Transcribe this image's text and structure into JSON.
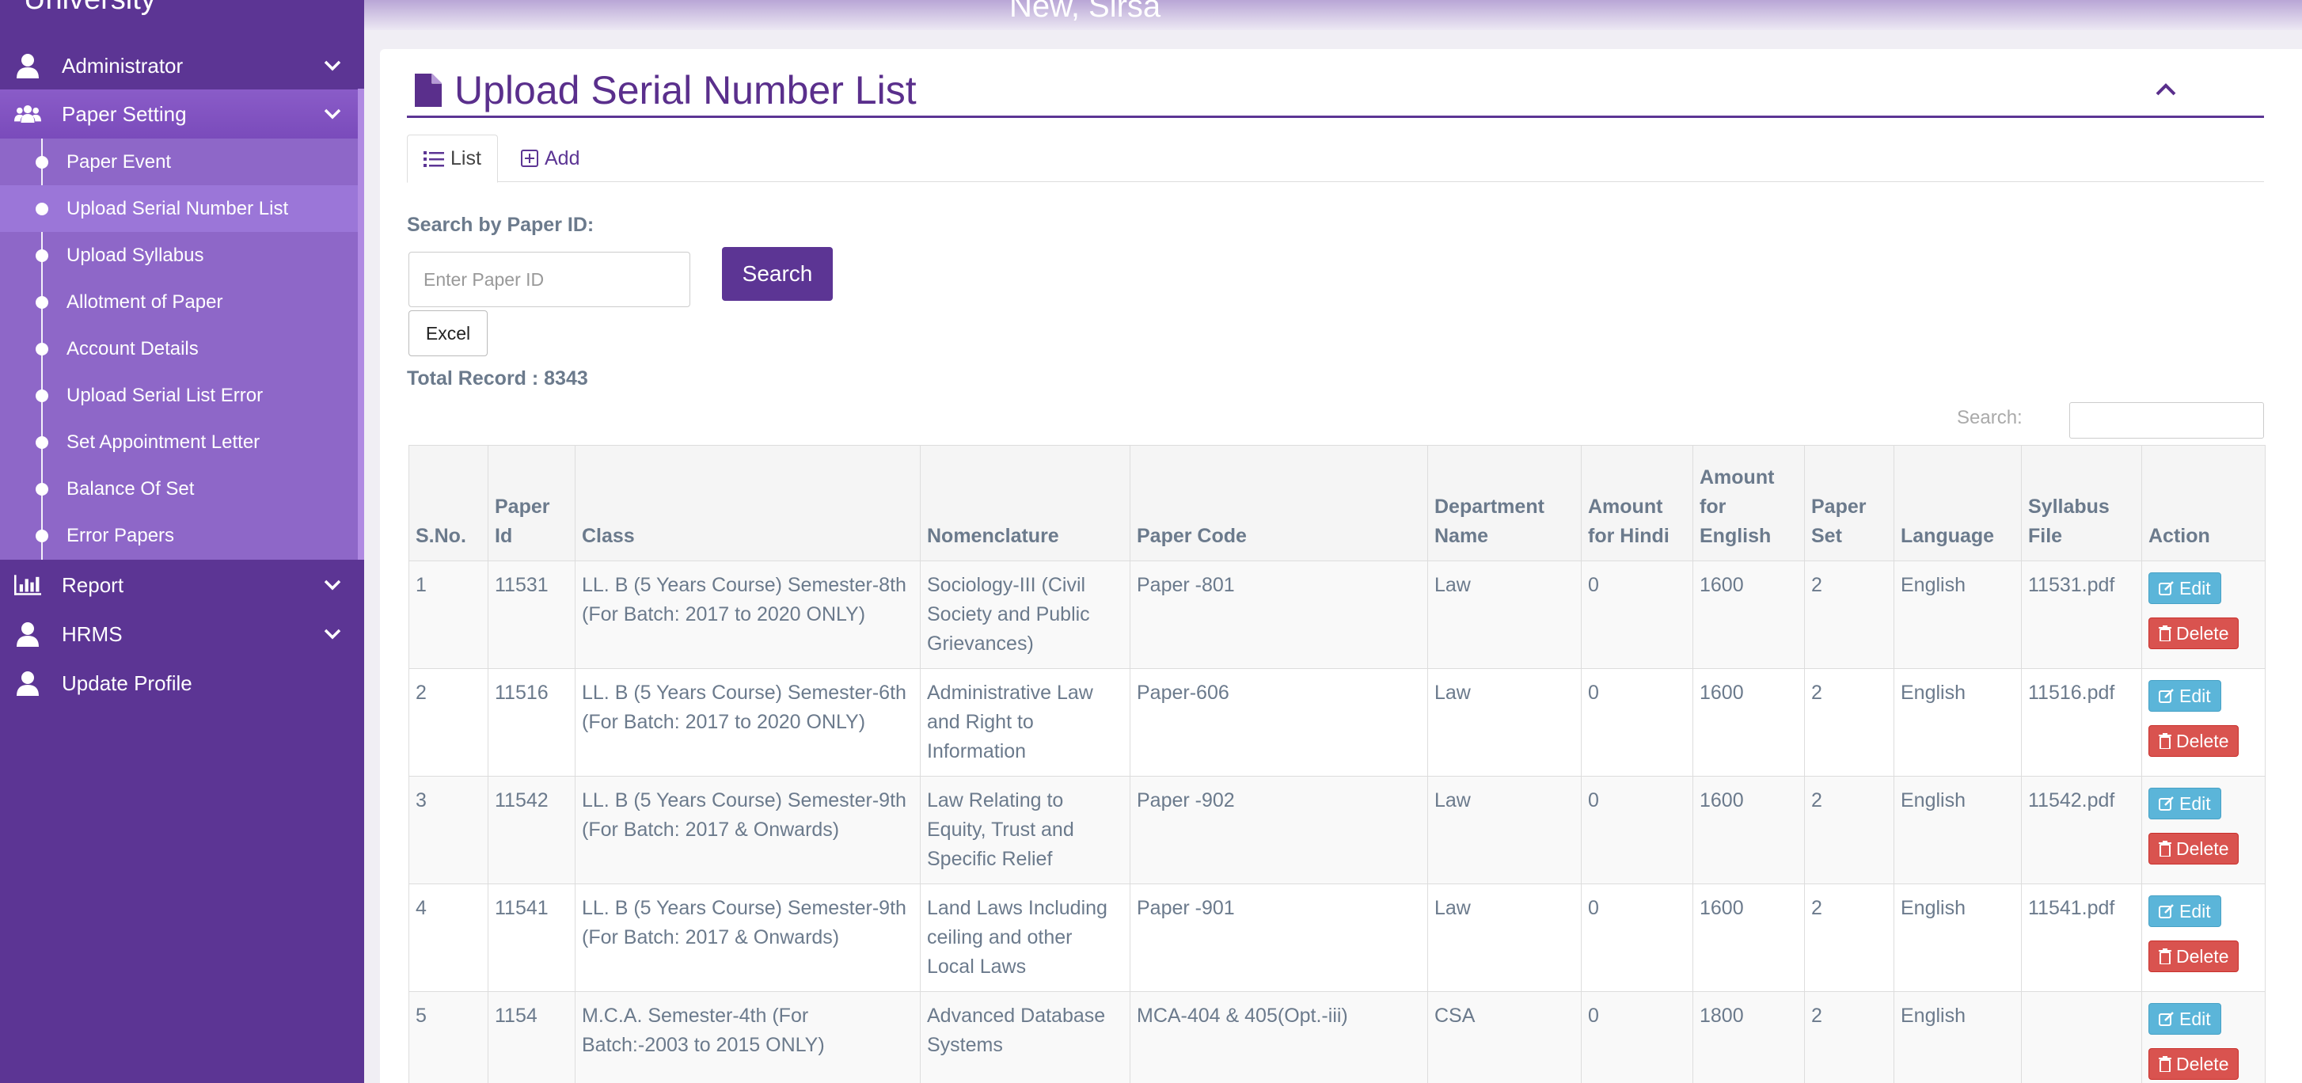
{
  "sidebar": {
    "brand": "University",
    "items": [
      {
        "label": "Administrator",
        "icon": "user-icon"
      },
      {
        "label": "Paper Setting",
        "icon": "users-icon"
      },
      {
        "label": "Report",
        "icon": "bar-chart-icon"
      },
      {
        "label": "HRMS",
        "icon": "user-icon"
      },
      {
        "label": "Update Profile",
        "icon": "user-icon"
      }
    ],
    "submenu": [
      "Paper Event",
      "Upload Serial Number List",
      "Upload Syllabus",
      "Allotment of Paper",
      "Account Details",
      "Upload Serial List Error",
      "Set Appointment Letter",
      "Balance Of Set",
      "Error Papers"
    ]
  },
  "header": {
    "title": "New, Sirsa"
  },
  "panel": {
    "title": "Upload Serial Number List"
  },
  "tabs": {
    "list": "List",
    "add": "Add"
  },
  "search": {
    "label": "Search by Paper ID:",
    "placeholder": "Enter Paper ID",
    "button": "Search",
    "excel": "Excel",
    "total": "Total Record : 8343",
    "table_search_label": "Search:"
  },
  "table": {
    "headers": [
      "S.No.",
      "Paper Id",
      "Class",
      "Nomenclature",
      "Paper Code",
      "Department Name",
      "Amount for Hindi",
      "Amount for English",
      "Paper Set",
      "Language",
      "Syllabus File",
      "Action"
    ],
    "rows": [
      [
        "1",
        "11531",
        "LL. B (5 Years Course) Semester-8th (For Batch: 2017 to 2020 ONLY)",
        "Sociology-III (Civil Society and Public Grievances)",
        "Paper -801",
        "Law",
        "0",
        "1600",
        "2",
        "English",
        "11531.pdf"
      ],
      [
        "2",
        "11516",
        "LL. B (5 Years Course) Semester-6th (For Batch: 2017 to 2020 ONLY)",
        "Administrative Law and Right to Information",
        "Paper-606",
        "Law",
        "0",
        "1600",
        "2",
        "English",
        "11516.pdf"
      ],
      [
        "3",
        "11542",
        "LL. B (5 Years Course) Semester-9th (For Batch: 2017 & Onwards)",
        "Law Relating to Equity, Trust and Specific Relief",
        "Paper -902",
        "Law",
        "0",
        "1600",
        "2",
        "English",
        "11542.pdf"
      ],
      [
        "4",
        "11541",
        "LL. B (5 Years Course) Semester-9th (For Batch: 2017 & Onwards)",
        "Land Laws Including ceiling and other Local Laws",
        "Paper -901",
        "Law",
        "0",
        "1600",
        "2",
        "English",
        "11541.pdf"
      ],
      [
        "5",
        "1154",
        "M.C.A. Semester-4th (For Batch:-2003 to 2015 ONLY)",
        "Advanced Database Systems",
        "MCA-404 & 405(Opt.-iii)",
        "CSA",
        "0",
        "1800",
        "2",
        "English",
        ""
      ]
    ],
    "edit_label": "Edit",
    "delete_label": "Delete"
  }
}
